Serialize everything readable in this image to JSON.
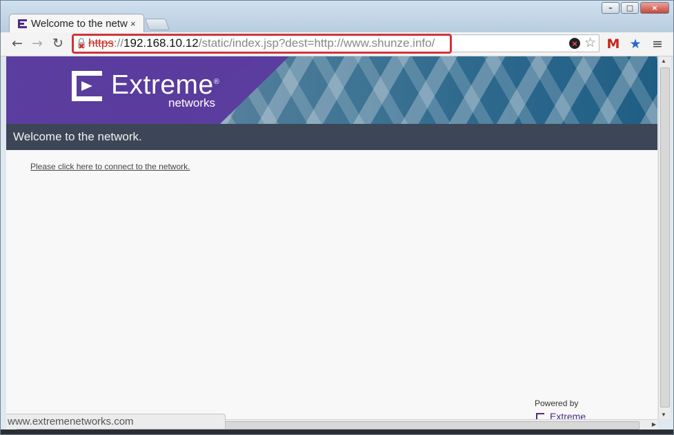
{
  "browser": {
    "tab": {
      "title": "Welcome to the network.",
      "close": "×"
    },
    "window_controls": {
      "minimize": "–",
      "maximize": "□",
      "close": "×"
    },
    "nav": {
      "back": "←",
      "forward": "→",
      "reload": "↻",
      "menu": "≡"
    },
    "address": {
      "scheme": "https",
      "sep": "://",
      "host": "192.168.10.12",
      "path": "/static/index.jsp?dest=http://www.shunze.info/"
    },
    "extensions": {
      "gmail": "M",
      "bookmark_star": "★"
    }
  },
  "page": {
    "brand": {
      "name": "Extreme",
      "registered": "®",
      "sub": "networks"
    },
    "header_title": "Welcome to the network.",
    "connect_link": "Please click here to connect to the network.",
    "powered_by": "Powered by",
    "powered_brand": "Extreme"
  },
  "status": {
    "hover_url": "www.extremenetworks.com"
  },
  "colors": {
    "brand_purple": "#5b3d9f",
    "header_bar": "#3d4656",
    "highlight_red": "#d0333a"
  }
}
